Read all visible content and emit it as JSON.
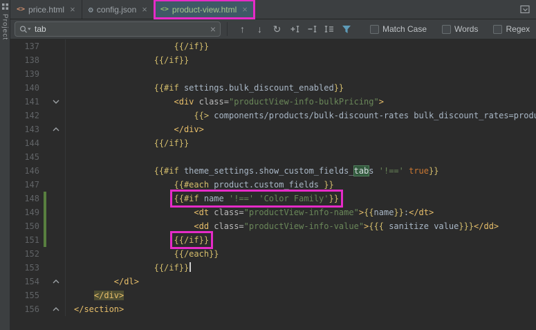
{
  "colors": {
    "annotation_magenta": "#E62BC8",
    "editor_bg": "#2B2B2B",
    "panel_bg": "#3C3F41",
    "active_tab_bg": "#3E5966",
    "string_green": "#6A8759",
    "tag_yellow": "#E8BF6A",
    "mustache_khaki": "#D5BE6C",
    "vcs_added_green": "#587F3F",
    "search_hit_bg": "#32593D"
  },
  "tool_stripe": {
    "label": "Project"
  },
  "tabs": [
    {
      "label": "price.html",
      "icon": "html",
      "active": false,
      "annotated": false
    },
    {
      "label": "config.json",
      "icon": "json",
      "active": false,
      "annotated": false
    },
    {
      "label": "product-view.html",
      "icon": "html",
      "active": true,
      "annotated": true
    }
  ],
  "find_bar": {
    "query": "tab",
    "options": [
      {
        "label": "Match Case",
        "checked": false
      },
      {
        "label": "Words",
        "checked": false
      },
      {
        "label": "Regex",
        "checked": false
      }
    ]
  },
  "editor": {
    "lines": [
      {
        "num": 137,
        "indent": "                    ",
        "segs": [
          {
            "c": "hb",
            "t": "{{/if}}"
          }
        ]
      },
      {
        "num": 138,
        "indent": "                ",
        "segs": [
          {
            "c": "hb",
            "t": "{{/if}}"
          }
        ]
      },
      {
        "num": 139,
        "indent": "",
        "segs": []
      },
      {
        "num": 140,
        "indent": "                ",
        "segs": [
          {
            "c": "hb",
            "t": "{{#if "
          },
          {
            "c": "id",
            "t": "settings.bulk_discount_enabled"
          },
          {
            "c": "hb",
            "t": "}}"
          }
        ]
      },
      {
        "num": 141,
        "indent": "                    ",
        "fold": "down",
        "segs": [
          {
            "c": "tag",
            "t": "<div"
          },
          {
            "c": "attr",
            "t": " class="
          },
          {
            "c": "str",
            "t": "\"productView-info-bulkPricing\""
          },
          {
            "c": "tag",
            "t": ">"
          }
        ]
      },
      {
        "num": 142,
        "indent": "                        ",
        "segs": [
          {
            "c": "hb",
            "t": "{{> "
          },
          {
            "c": "id",
            "t": "components/products/bulk-discount-rates bulk_discount_rates=product.bulk_discount_rates"
          },
          {
            "c": "hb",
            "t": "}}"
          }
        ]
      },
      {
        "num": 143,
        "indent": "                    ",
        "fold": "up",
        "segs": [
          {
            "c": "tag",
            "t": "</div>"
          }
        ]
      },
      {
        "num": 144,
        "indent": "                ",
        "segs": [
          {
            "c": "hb",
            "t": "{{/if}}"
          }
        ]
      },
      {
        "num": 145,
        "indent": "",
        "segs": []
      },
      {
        "num": 146,
        "indent": "                ",
        "segs": [
          {
            "c": "hb",
            "t": "{{#if "
          },
          {
            "c": "id",
            "t": "theme_settings.show_custom_fields_"
          },
          {
            "c": "hit",
            "t": "tab"
          },
          {
            "c": "id",
            "t": "s"
          },
          {
            "c": "plain",
            "t": " "
          },
          {
            "c": "str",
            "t": "'!=='"
          },
          {
            "c": "plain",
            "t": " "
          },
          {
            "c": "kw",
            "t": "true"
          },
          {
            "c": "hb",
            "t": "}}"
          }
        ]
      },
      {
        "num": 147,
        "indent": "                    ",
        "segs": [
          {
            "c": "hb",
            "t": "{{#each "
          },
          {
            "c": "id",
            "t": "product.custom_fields "
          },
          {
            "c": "hb",
            "t": "}}"
          }
        ]
      },
      {
        "num": 148,
        "indent": "                    ",
        "boxed": true,
        "changed": true,
        "segs": [
          {
            "c": "hb",
            "t": "{{#if "
          },
          {
            "c": "id",
            "t": "name"
          },
          {
            "c": "plain",
            "t": " "
          },
          {
            "c": "str",
            "t": "'!=='"
          },
          {
            "c": "plain",
            "t": " "
          },
          {
            "c": "str",
            "t": "'Color Family'"
          },
          {
            "c": "hb",
            "t": "}}"
          }
        ]
      },
      {
        "num": 149,
        "indent": "                        ",
        "changed": true,
        "segs": [
          {
            "c": "tag",
            "t": "<dt"
          },
          {
            "c": "attr",
            "t": " class="
          },
          {
            "c": "str",
            "t": "\"productView-info-name\""
          },
          {
            "c": "tag",
            "t": ">"
          },
          {
            "c": "hb",
            "t": "{{"
          },
          {
            "c": "id",
            "t": "name"
          },
          {
            "c": "hb",
            "t": "}}"
          },
          {
            "c": "plain",
            "t": ":"
          },
          {
            "c": "tag",
            "t": "</dt>"
          }
        ]
      },
      {
        "num": 150,
        "indent": "                        ",
        "changed": true,
        "segs": [
          {
            "c": "tag",
            "t": "<dd"
          },
          {
            "c": "attr",
            "t": " class="
          },
          {
            "c": "str",
            "t": "\"productView-info-value\""
          },
          {
            "c": "tag",
            "t": ">"
          },
          {
            "c": "hb",
            "t": "{{{ "
          },
          {
            "c": "id",
            "t": "sanitize value"
          },
          {
            "c": "hb",
            "t": "}}}"
          },
          {
            "c": "tag",
            "t": "</dd>"
          }
        ]
      },
      {
        "num": 151,
        "indent": "                    ",
        "boxed": true,
        "changed": true,
        "segs": [
          {
            "c": "hb",
            "t": "{{/if}}"
          }
        ]
      },
      {
        "num": 152,
        "indent": "                    ",
        "segs": [
          {
            "c": "hb",
            "t": "{{/each}}"
          }
        ]
      },
      {
        "num": 153,
        "indent": "                ",
        "cursor": true,
        "segs": [
          {
            "c": "hb",
            "t": "{{/if}}"
          }
        ]
      },
      {
        "num": 154,
        "indent": "        ",
        "fold": "up",
        "segs": [
          {
            "c": "tag",
            "t": "</dl>"
          }
        ]
      },
      {
        "num": 155,
        "indent": "    ",
        "segs": [
          {
            "c": "tagmatch",
            "t": "</div>"
          }
        ]
      },
      {
        "num": 156,
        "indent": "",
        "fold": "up",
        "segs": [
          {
            "c": "tag",
            "t": "</section>"
          }
        ]
      }
    ]
  }
}
